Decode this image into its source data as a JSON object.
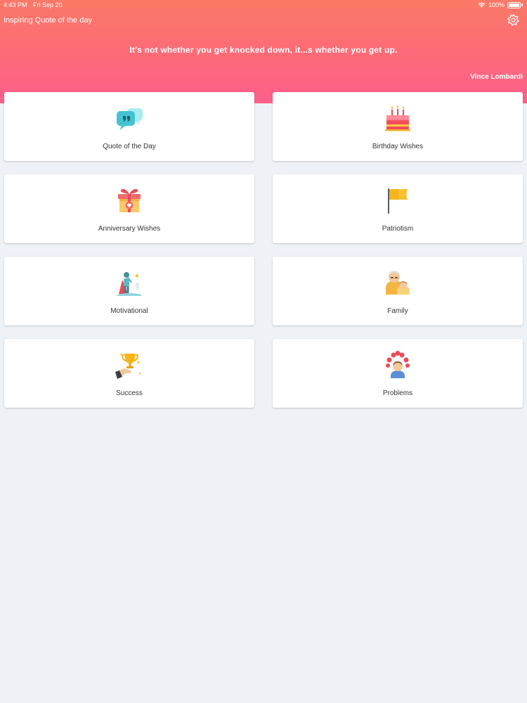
{
  "status_bar": {
    "time": "4:43 PM",
    "date": "Fri Sep 20",
    "battery": "100%",
    "battery_level": 1.0
  },
  "header": {
    "title": "Inspiring Quote of the day",
    "quote": "It's not whether you get knocked down, it...s whether you get up.",
    "author": "Vince Lombardi",
    "settings_icon": "gear-icon"
  },
  "colors": {
    "header_gradient_top": "#fb7966",
    "header_gradient_bottom": "#fd5f8b",
    "background": "#eef1f6"
  },
  "categories": [
    {
      "label": "Quote of the Day",
      "icon": "speech-bubbles-icon"
    },
    {
      "label": "Birthday Wishes",
      "icon": "birthday-cake-icon"
    },
    {
      "label": "Anniversary Wishes",
      "icon": "gift-box-icon"
    },
    {
      "label": "Patriotism",
      "icon": "flag-icon"
    },
    {
      "label": "Motivational",
      "icon": "superhero-icon"
    },
    {
      "label": "Family",
      "icon": "family-icon"
    },
    {
      "label": "Success",
      "icon": "trophy-icon"
    },
    {
      "label": "Problems",
      "icon": "confused-person-icon"
    }
  ]
}
